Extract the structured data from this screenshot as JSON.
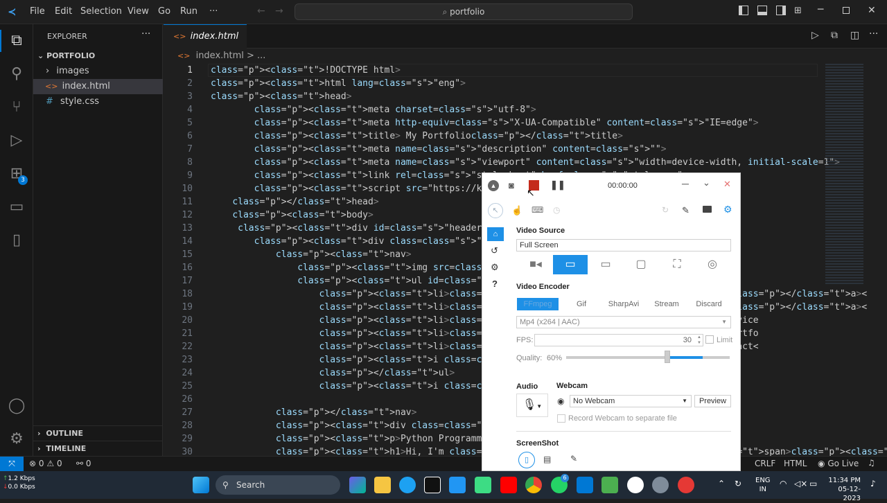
{
  "titlebar": {
    "menu": [
      "File",
      "Edit",
      "Selection",
      "View",
      "Go",
      "Run",
      "···"
    ],
    "search": "portfolio"
  },
  "sidebar": {
    "title": "EXPLORER",
    "root": "PORTFOLIO",
    "items": [
      {
        "label": "images",
        "type": "folder"
      },
      {
        "label": "index.html",
        "type": "html"
      },
      {
        "label": "style.css",
        "type": "css"
      }
    ],
    "outline": "OUTLINE",
    "timeline": "TIMELINE"
  },
  "editor": {
    "tab": "index.html",
    "breadcrumb": "index.html > ...",
    "lines": [
      {
        "n": "1",
        "text": "<!DOCTYPE html>"
      },
      {
        "n": "2",
        "text": "<html lang=\"eng\">"
      },
      {
        "n": "3",
        "text": "<head>"
      },
      {
        "n": "4",
        "text": "        <meta charset=\"utf-8\">"
      },
      {
        "n": "5",
        "text": "        <meta http-equiv=\"X-UA-Compatible\" content=\"IE=edge\">"
      },
      {
        "n": "6",
        "text": "        <title> My Portfolio</title>"
      },
      {
        "n": "7",
        "text": "        <meta name=\"description\" content=\"\">"
      },
      {
        "n": "8",
        "text": "        <meta name=\"viewport\" content=\"width=device-width, initial-scale=1\">"
      },
      {
        "n": "9",
        "text": "        <link rel=\"stylesheet\" href=\"style.css\">"
      },
      {
        "n": "10",
        "text": "        <script src=\"https://kit.fontawesome.com/53"
      },
      {
        "n": "11",
        "text": "    </head>"
      },
      {
        "n": "12",
        "text": "    <body>"
      },
      {
        "n": "13",
        "text": "     <div id=\"header\">"
      },
      {
        "n": "14",
        "text": "        <div class=\"container\">"
      },
      {
        "n": "15",
        "text": "            <nav>"
      },
      {
        "n": "16",
        "text": "                <img src=\"images/my_logo.png\", clas"
      },
      {
        "n": "17",
        "text": "                <ul id=\"sidemenu\">"
      },
      {
        "n": "18",
        "text": "                    <li><a href=\"#header\">Home</a><"
      },
      {
        "n": "19",
        "text": "                    <li><a href=\"#about\">About</a><"
      },
      {
        "n": "20",
        "text": "                    <li><a href=\"#services\">Service"
      },
      {
        "n": "21",
        "text": "                    <li><a href=\"#portfolio\">Portfo"
      },
      {
        "n": "22",
        "text": "                    <li><a href=\"#contact\">Contact<"
      },
      {
        "n": "23",
        "text": "                    <i class=\"fa-solid fa-xmark\" on"
      },
      {
        "n": "24",
        "text": "                    </ul>"
      },
      {
        "n": "25",
        "text": "                    <i class=\"fa-solid fa-bars\"  on"
      },
      {
        "n": "26",
        "text": ""
      },
      {
        "n": "27",
        "text": "            </nav>"
      },
      {
        "n": "28",
        "text": "            <div class=\"header-text\">"
      },
      {
        "n": "29",
        "text": "            <p>Python Programmer</p>"
      },
      {
        "n": "30",
        "text": "            <h1>Hi, I'm <span>Souvik Gon</span><br>"
      }
    ]
  },
  "status": {
    "errors": "0",
    "warnings": "0",
    "ports": "0",
    "eol": "CRLF",
    "lang": "HTML",
    "golive": "Go Live"
  },
  "taskbar": {
    "search": "Search",
    "net_up": "1.2 Kbps",
    "net_down": "0.0 Kbps",
    "lang1": "ENG",
    "lang2": "IN",
    "time": "11:34 PM",
    "date": "05-12-2023",
    "whatsapp_badge": "6"
  },
  "recorder": {
    "timer": "00:00:00",
    "video_source_label": "Video Source",
    "video_source_value": "Full Screen",
    "video_encoder_label": "Video Encoder",
    "encoder_tabs": [
      "FFmpeg",
      "Gif",
      "SharpAvi",
      "Stream",
      "Discard"
    ],
    "encoder_value": "Mp4 (x264 | AAC)",
    "fps_label": "FPS:",
    "fps_value": "30",
    "limit_label": "Limit",
    "quality_label": "Quality:",
    "quality_value": "60%",
    "quality": 0.6,
    "audio_label": "Audio",
    "webcam_label": "Webcam",
    "webcam_value": "No Webcam",
    "preview_label": "Preview",
    "record_webcam_label": "Record Webcam to separate file",
    "screenshot_label": "ScreenShot"
  },
  "colors": {
    "accent": "#0078d4",
    "rec_red": "#c42b1c",
    "rec_blue": "#1e90e6"
  }
}
